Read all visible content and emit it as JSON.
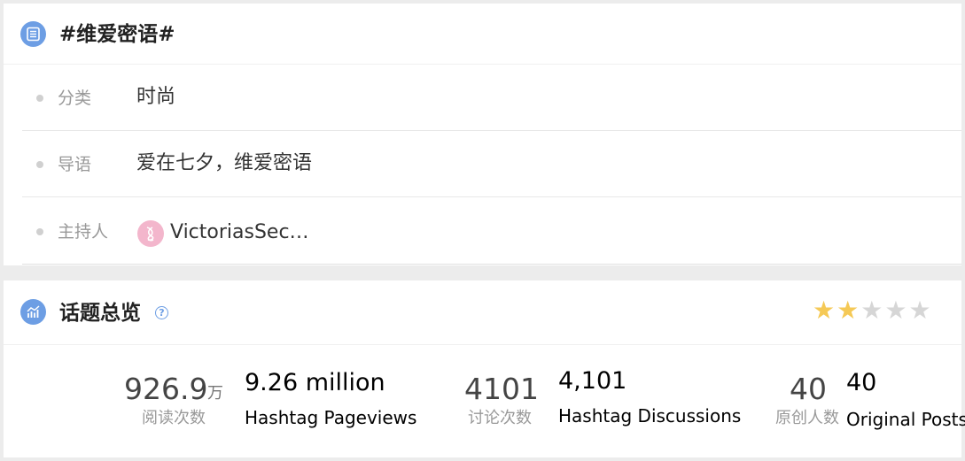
{
  "topic": {
    "title": "#维爱密语#",
    "category_label": "分类",
    "category_value": "时尚",
    "guide_label": "导语",
    "guide_value": "爱在七夕，维爱密语",
    "host_label": "主持人",
    "host_name": "VictoriasSec…"
  },
  "overview": {
    "title": "话题总览",
    "rating": {
      "value": 2,
      "max": 5
    },
    "stats": [
      {
        "number": "926.9",
        "unit": "万",
        "label": "阅读次数",
        "en_value": "9.26 million",
        "en_label": "Hashtag Pageviews"
      },
      {
        "number": "4101",
        "unit": "",
        "label": "讨论次数",
        "en_value": "4,101",
        "en_label": "Hashtag Discussions"
      },
      {
        "number": "40",
        "unit": "",
        "label": "原创人数",
        "en_value": "40",
        "en_label": "Original Posts"
      }
    ]
  },
  "colors": {
    "accent": "#6d9ee4",
    "star_on": "#f5c956",
    "star_off": "#d6d6d6",
    "avatar": "#f3b6cc"
  },
  "icons": {
    "topic": "document-list-icon",
    "overview": "chart-trend-icon",
    "help": "question-circle-icon",
    "rating": "star-icon"
  }
}
